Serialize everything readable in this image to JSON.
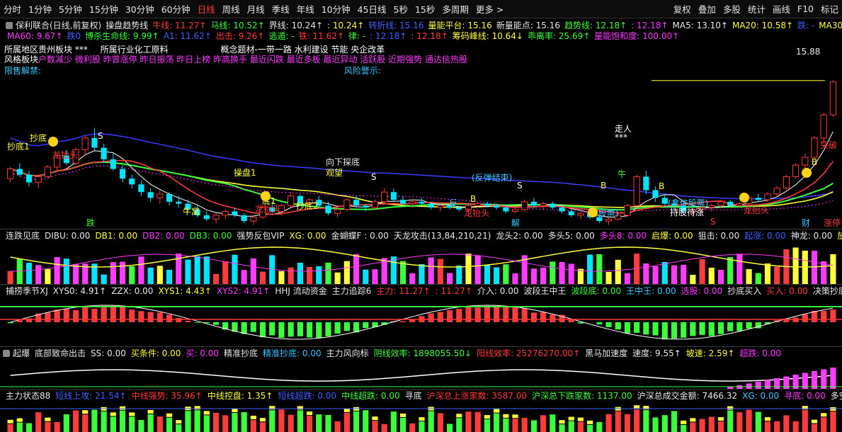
{
  "toolbar": {
    "periods": [
      "分时",
      "1分钟",
      "5分钟",
      "15分钟",
      "30分钟",
      "60分钟",
      "日线",
      "周线",
      "月线",
      "季线",
      "年线",
      "10分钟",
      "45日线",
      "5秒",
      "15秒",
      "多周期",
      "更多 >"
    ],
    "active_index": 6,
    "tools": [
      "复权",
      "叠加",
      "多股",
      "统计",
      "画线",
      "F10",
      "标记"
    ]
  },
  "info1": [
    {
      "t": "保利联合(日线,前复权)",
      "c": "#e8e8e8"
    },
    {
      "t": "操盘趋势线",
      "c": "#e8e8e8"
    },
    {
      "t": "牛线: 11.27↑",
      "c": "#ff3b3b"
    },
    {
      "t": "马线: 10.52↑",
      "c": "#3bff3b"
    },
    {
      "t": "界线: 10.24↑",
      "c": "#e8e8e8"
    },
    {
      "t": ": 10.24↑",
      "c": "#ffff3b"
    },
    {
      "t": "转折线: 15.16",
      "c": "#4060ff"
    },
    {
      "t": "量能平台: 15.16",
      "c": "#ffff3b"
    },
    {
      "t": "新量能点: 15.16",
      "c": "#e8e8e8"
    },
    {
      "t": "趋势线: 12.18↑",
      "c": "#3bff3b"
    },
    {
      "t": ": 12.18↑",
      "c": "#ff3bff"
    },
    {
      "t": "MA5: 13.10↑",
      "c": "#e8e8e8"
    },
    {
      "t": "MA20: 10.58↑",
      "c": "#ffff3b"
    },
    {
      "t": "跌: -",
      "c": "#4060ff"
    },
    {
      "t": "MA30: 10.23↑",
      "c": "#ffff3b"
    }
  ],
  "info2": [
    {
      "t": "MA60: 9.67↑",
      "c": "#ff3bff"
    },
    {
      "t": "跌0",
      "c": "#4060ff"
    },
    {
      "t": "博杀生命线: 9.99↑",
      "c": "#3bff3b"
    },
    {
      "t": "A1: 11.62↑",
      "c": "#4060ff"
    },
    {
      "t": "出击: 9.26↑",
      "c": "#ff3b3b"
    },
    {
      "t": "逃遁: -",
      "c": "#3bff3b"
    },
    {
      "t": "铁: 11.62↑",
      "c": "#ff3b3b"
    },
    {
      "t": "律: -",
      "c": "#3bff3b"
    },
    {
      "t": ": 12.18↑",
      "c": "#4060ff"
    },
    {
      "t": ": 12.18↑",
      "c": "#ff3b3b"
    },
    {
      "t": "筹码峰线: 10.64↓",
      "c": "#ffff3b"
    },
    {
      "t": "乖离率: 25.69↑",
      "c": "#3bff3b"
    },
    {
      "t": "量能饱和度: 100.00↑",
      "c": "#ff3bff"
    }
  ],
  "info3": {
    "region": "所属地区贵州板块 ***",
    "industry": "所属行业化工原料",
    "concept": "概念题材-一带一路 水利建设 节能 央企改革"
  },
  "info4": {
    "label": "风格板块",
    "text": "户数减少 微利股 昨曾涨停 昨日振荡 昨日上榜 昨高换手 最近闪跌 最近多板 最近异动 活跃股 近期强势 通达信热股"
  },
  "info5": {
    "lift": "限售解禁:",
    "risk": "风险警示:"
  },
  "price_label": "15.88",
  "main_chart": {
    "ohlc": [
      [
        10.8,
        11.4,
        10.6,
        11.3
      ],
      [
        11.3,
        11.6,
        10.9,
        11.0
      ],
      [
        11.0,
        11.2,
        10.4,
        10.6
      ],
      [
        10.6,
        11.0,
        10.3,
        10.9
      ],
      [
        10.9,
        11.5,
        10.8,
        11.4
      ],
      [
        11.4,
        12.1,
        11.2,
        12.0
      ],
      [
        12.0,
        12.3,
        11.5,
        11.6
      ],
      [
        11.6,
        12.4,
        11.5,
        12.3
      ],
      [
        12.3,
        13.0,
        12.0,
        12.9
      ],
      [
        12.9,
        13.4,
        12.2,
        12.4
      ],
      [
        12.4,
        12.6,
        11.6,
        11.8
      ],
      [
        11.8,
        12.1,
        11.2,
        11.3
      ],
      [
        11.3,
        11.5,
        10.6,
        10.8
      ],
      [
        10.8,
        11.0,
        10.3,
        10.5
      ],
      [
        10.5,
        10.7,
        9.9,
        10.1
      ],
      [
        10.1,
        10.3,
        9.6,
        9.8
      ],
      [
        9.8,
        10.2,
        9.5,
        10.0
      ],
      [
        10.0,
        10.1,
        9.4,
        9.6
      ],
      [
        9.6,
        9.9,
        9.3,
        9.5
      ],
      [
        9.5,
        9.7,
        9.1,
        9.2
      ],
      [
        9.2,
        9.4,
        8.8,
        8.9
      ],
      [
        8.9,
        9.1,
        8.6,
        8.7
      ],
      [
        8.7,
        9.0,
        8.5,
        8.9
      ],
      [
        8.9,
        9.2,
        8.7,
        9.1
      ],
      [
        9.1,
        9.3,
        8.8,
        8.9
      ],
      [
        8.9,
        9.0,
        8.5,
        8.6
      ],
      [
        8.6,
        8.9,
        8.4,
        8.8
      ],
      [
        8.8,
        9.4,
        8.7,
        9.3
      ],
      [
        9.3,
        9.6,
        9.0,
        9.1
      ],
      [
        9.1,
        9.5,
        8.9,
        9.4
      ],
      [
        9.4,
        10.1,
        9.3,
        9.9
      ],
      [
        9.9,
        10.0,
        9.4,
        9.5
      ],
      [
        9.5,
        9.8,
        9.3,
        9.7
      ],
      [
        9.7,
        9.9,
        9.3,
        9.4
      ],
      [
        9.4,
        9.6,
        8.9,
        9.0
      ],
      [
        9.0,
        9.3,
        8.8,
        9.2
      ],
      [
        9.2,
        9.8,
        9.1,
        9.7
      ],
      [
        9.7,
        9.9,
        9.3,
        9.4
      ],
      [
        9.4,
        9.5,
        9.1,
        9.3
      ],
      [
        9.3,
        9.7,
        9.2,
        9.6
      ],
      [
        9.6,
        10.3,
        9.5,
        10.1
      ],
      [
        10.1,
        10.3,
        9.6,
        9.7
      ],
      [
        9.7,
        9.9,
        9.4,
        9.5
      ],
      [
        9.5,
        9.7,
        9.3,
        9.6
      ],
      [
        9.6,
        9.8,
        9.4,
        9.5
      ],
      [
        9.5,
        9.6,
        9.2,
        9.3
      ],
      [
        9.3,
        9.5,
        9.1,
        9.4
      ],
      [
        9.4,
        9.5,
        9.2,
        9.3
      ],
      [
        9.3,
        9.4,
        9.1,
        9.2
      ],
      [
        9.2,
        9.5,
        9.1,
        9.4
      ],
      [
        9.4,
        9.6,
        9.3,
        9.5
      ],
      [
        9.5,
        9.6,
        9.3,
        9.4
      ],
      [
        9.4,
        9.5,
        9.2,
        9.3
      ],
      [
        9.3,
        9.4,
        9.0,
        9.1
      ],
      [
        9.1,
        9.3,
        9.0,
        9.2
      ],
      [
        9.2,
        9.7,
        9.1,
        9.6
      ],
      [
        9.6,
        9.8,
        9.3,
        9.4
      ],
      [
        9.4,
        9.6,
        9.2,
        9.5
      ],
      [
        9.5,
        9.6,
        9.2,
        9.3
      ],
      [
        9.3,
        9.4,
        9.0,
        9.1
      ],
      [
        9.1,
        9.2,
        8.8,
        8.9
      ],
      [
        8.9,
        9.1,
        8.7,
        9.0
      ],
      [
        9.0,
        9.1,
        8.7,
        8.8
      ],
      [
        8.8,
        8.9,
        8.5,
        8.6
      ],
      [
        8.6,
        8.8,
        8.4,
        8.7
      ],
      [
        8.7,
        9.0,
        8.6,
        8.9
      ],
      [
        8.9,
        9.5,
        8.8,
        9.4
      ],
      [
        9.4,
        11.0,
        9.3,
        10.9
      ],
      [
        10.9,
        11.2,
        10.0,
        10.2
      ],
      [
        10.2,
        10.4,
        9.6,
        9.8
      ],
      [
        9.8,
        10.0,
        9.3,
        9.5
      ],
      [
        9.5,
        9.7,
        9.2,
        9.4
      ],
      [
        9.4,
        9.6,
        9.0,
        9.1
      ],
      [
        9.1,
        9.3,
        8.9,
        9.2
      ],
      [
        9.2,
        9.4,
        9.0,
        9.3
      ],
      [
        9.3,
        9.5,
        9.1,
        9.4
      ],
      [
        9.4,
        9.7,
        9.3,
        9.6
      ],
      [
        9.6,
        9.7,
        9.3,
        9.4
      ],
      [
        9.4,
        9.6,
        9.3,
        9.5
      ],
      [
        9.5,
        9.9,
        9.4,
        9.8
      ],
      [
        9.8,
        10.0,
        9.6,
        9.7
      ],
      [
        9.7,
        10.1,
        9.6,
        10.0
      ],
      [
        10.0,
        10.4,
        9.9,
        10.3
      ],
      [
        10.3,
        11.0,
        10.2,
        10.9
      ],
      [
        10.9,
        11.6,
        10.8,
        11.5
      ],
      [
        11.5,
        12.1,
        11.3,
        11.9
      ],
      [
        11.9,
        13.0,
        11.8,
        12.9
      ],
      [
        12.9,
        14.2,
        12.7,
        14.1
      ],
      [
        14.1,
        15.9,
        14.0,
        15.8
      ]
    ],
    "ylim": [
      8.2,
      16.2
    ]
  },
  "annotations": [
    {
      "t": "抄底1",
      "c": "#ffff3b"
    },
    {
      "t": "抄底",
      "c": "#ffff3b"
    },
    {
      "t": "龙抬头",
      "c": "#ff3b3b"
    },
    {
      "t": "跌",
      "c": "#3bff3b"
    },
    {
      "t": "S",
      "c": "#ffffff"
    },
    {
      "t": "牛窝",
      "c": "#ffff3b"
    },
    {
      "t": "龙抬头",
      "c": "#ff3b3b"
    },
    {
      "t": "抄底2",
      "c": "#ffff3b"
    },
    {
      "t": "操盘1",
      "c": "#ffff3b"
    },
    {
      "t": "底1",
      "c": "#ffff3b"
    },
    {
      "t": "向下探底",
      "c": "#e8e8e8"
    },
    {
      "t": "观望",
      "c": "#ffff3b"
    },
    {
      "t": "S",
      "c": "#ffffff"
    },
    {
      "t": "(反弹结束)",
      "c": "#3bc8ff"
    },
    {
      "t": "反",
      "c": "#3bc8ff"
    },
    {
      "t": "B",
      "c": "#ffff3b"
    },
    {
      "t": "龙抬头",
      "c": "#ff3b3b"
    },
    {
      "t": "解",
      "c": "#3bc8ff"
    },
    {
      "t": "S",
      "c": "#ffffff"
    },
    {
      "t": "(股票)",
      "c": "#3bc8ff"
    },
    {
      "t": "B",
      "c": "#ffff3b"
    },
    {
      "t": "走人",
      "c": "#ffffff"
    },
    {
      "t": "***",
      "c": "#ffffff"
    },
    {
      "t": "B",
      "c": "#ffff3b"
    },
    {
      "t": "(拿住股票)",
      "c": "#3bc8ff"
    },
    {
      "t": "持股待涨",
      "c": "#ffffff"
    },
    {
      "t": "S",
      "c": "#ff3b3b"
    },
    {
      "t": "龙抬头",
      "c": "#ff3b3b"
    },
    {
      "t": "财",
      "c": "#3bc8ff"
    },
    {
      "t": "涨停",
      "c": "#ff3b3b"
    },
    {
      "t": "突破",
      "c": "#ff3b3b"
    },
    {
      "t": "B",
      "c": "#ffff3b"
    },
    {
      "t": "牛",
      "c": "#3bff3b"
    }
  ],
  "panels": [
    {
      "name": "vol-panel",
      "items": [
        {
          "t": "连跌见底",
          "c": "#e8e8e8"
        },
        {
          "t": "DIBU: 0.00",
          "c": "#e8e8e8"
        },
        {
          "t": "DB1: 0.00",
          "c": "#ffff3b"
        },
        {
          "t": "DB2: 0.00",
          "c": "#ff3bff"
        },
        {
          "t": "DB3: 0.00",
          "c": "#3bff3b"
        },
        {
          "t": "强势反包VIP",
          "c": "#e8e8e8"
        },
        {
          "t": "XG: 0.00",
          "c": "#ffff3b"
        },
        {
          "t": "金蝴蝶F : 0.00",
          "c": "#e8e8e8"
        },
        {
          "t": "天龙攻击(13,84,210,21)",
          "c": "#e8e8e8"
        },
        {
          "t": "龙头2: 0.00",
          "c": "#e8e8e8"
        },
        {
          "t": "多头5: 0.00",
          "c": "#e8e8e8"
        },
        {
          "t": "多头8: 0.00",
          "c": "#ff3bff"
        },
        {
          "t": "启爆: 0.00",
          "c": "#ffff3b"
        },
        {
          "t": "狙击: 0.00",
          "c": "#e8e8e8"
        },
        {
          "t": "起涨: 0.00",
          "c": "#4060ff"
        },
        {
          "t": "神龙: 0.00",
          "c": "#e8e8e8"
        },
        {
          "t": "放量: 0.00",
          "c": "#ffff3b"
        },
        {
          "t": "龙回头",
          "c": "#ff3bff"
        }
      ]
    },
    {
      "name": "capture-panel",
      "items": [
        {
          "t": "捕捞季节XJ",
          "c": "#e8e8e8"
        },
        {
          "t": "XYS0: 4.91↑",
          "c": "#e8e8e8"
        },
        {
          "t": "ZZX: 0.00",
          "c": "#e8e8e8"
        },
        {
          "t": "XYS1: 4.43↑",
          "c": "#ffff3b"
        },
        {
          "t": "XYS2: 4.91↑",
          "c": "#ff3bff"
        },
        {
          "t": "HHJ 流动资金",
          "c": "#e8e8e8"
        },
        {
          "t": "主力追踪6",
          "c": "#e8e8e8"
        },
        {
          "t": "主力: 11.27↑",
          "c": "#ff3b3b"
        },
        {
          "t": ": 11.27↑",
          "c": "#ff3b3b"
        },
        {
          "t": "介入: 0.00",
          "c": "#e8e8e8"
        },
        {
          "t": "波段王中王",
          "c": "#e8e8e8"
        },
        {
          "t": "波段底: 0.00",
          "c": "#3bff3b"
        },
        {
          "t": "王中王: 0.00",
          "c": "#3bc8ff"
        },
        {
          "t": "选股: 0.00",
          "c": "#ff3bff"
        },
        {
          "t": "抄底买入",
          "c": "#e8e8e8"
        },
        {
          "t": "买入: 0.00",
          "c": "#ff3b3b"
        },
        {
          "t": "决策抄底",
          "c": "#e8e8e8"
        },
        {
          "t": "决策抄底: 0.00",
          "c": "#e8e8e8"
        }
      ]
    },
    {
      "name": "rise-panel",
      "items": [
        {
          "t": "起爆",
          "c": "#e8e8e8"
        },
        {
          "t": "底部致命出击",
          "c": "#e8e8e8"
        },
        {
          "t": "SS: 0.00",
          "c": "#e8e8e8"
        },
        {
          "t": "买条件: 0.00",
          "c": "#ffff3b"
        },
        {
          "t": "买: 0.00",
          "c": "#ff3bff"
        },
        {
          "t": "精准抄底",
          "c": "#e8e8e8"
        },
        {
          "t": "精准抄底: 0.00",
          "c": "#3bc8ff"
        },
        {
          "t": "主力风向标",
          "c": "#e8e8e8"
        },
        {
          "t": "阴线效率: 1898055.50↓",
          "c": "#3bff3b"
        },
        {
          "t": "阳线效率: 25276270.00↑",
          "c": "#ff3b3b"
        },
        {
          "t": "黑马加速度",
          "c": "#e8e8e8"
        },
        {
          "t": "速度: 9.55↑",
          "c": "#e8e8e8"
        },
        {
          "t": "坡速: 2.59↑",
          "c": "#ffff3b"
        },
        {
          "t": "超跌: 0.00",
          "c": "#ff3bff"
        }
      ]
    },
    {
      "name": "state-panel",
      "items": [
        {
          "t": "主力状态88",
          "c": "#e8e8e8"
        },
        {
          "t": "短线上攻: 21.54↑",
          "c": "#4060ff"
        },
        {
          "t": "中线强势: 35.96↑",
          "c": "#ff3b3b"
        },
        {
          "t": "中线控盘: 1.35↑",
          "c": "#ffff3b"
        },
        {
          "t": "短线超跌: 0.00",
          "c": "#4060ff"
        },
        {
          "t": "中线超跌: 0.00",
          "c": "#3bff3b"
        },
        {
          "t": "寻底",
          "c": "#e8e8e8"
        },
        {
          "t": "沪深总上涨家数: 3587.00",
          "c": "#ff3b3b"
        },
        {
          "t": "沪深总下跌家数: 1137.00",
          "c": "#3bff3b"
        },
        {
          "t": "沪深总成交金额: 7466.32",
          "c": "#e8e8e8"
        },
        {
          "t": "XG: 0.00",
          "c": "#3bc8ff"
        },
        {
          "t": "寻底: 0.00",
          "c": "#ff3bff"
        },
        {
          "t": "多空决策",
          "c": "#e8e8e8"
        },
        {
          "t": "启动",
          "c": "#e8e8e8"
        }
      ]
    }
  ],
  "colors": {
    "up": "#ff3b3b",
    "down": "#00e5ff",
    "ma_white": "#ffffff",
    "ma_yellow": "#ffff3b",
    "ma_green": "#3bff3b",
    "ma_blue": "#3b3bff",
    "ma_red": "#ff3b3b",
    "ma_purple": "#ff3bff"
  },
  "bottom_labels": {
    "left": "跌",
    "mid": "解",
    "right1": "财",
    "right2": "涨停",
    "marker": "S"
  }
}
